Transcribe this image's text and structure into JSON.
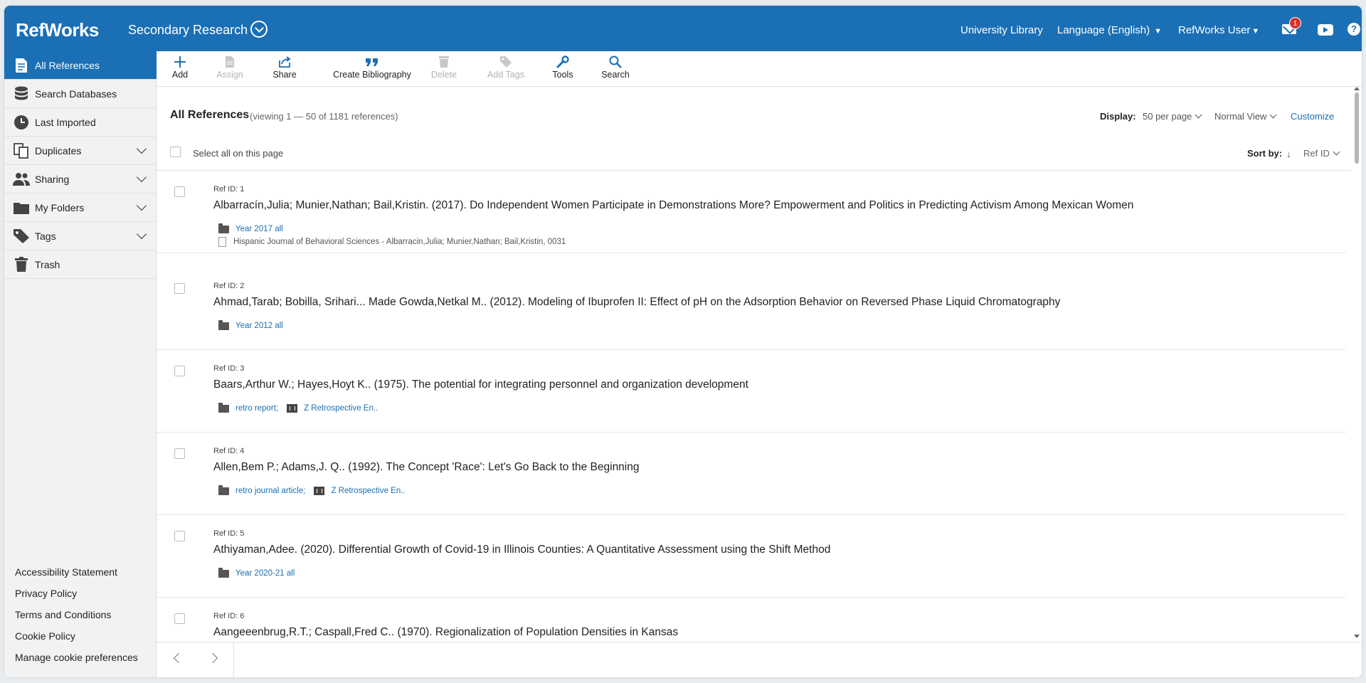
{
  "header": {
    "logo": "RefWorks",
    "project": "Secondary Research",
    "university_library": "University Library",
    "language": "Language (English)",
    "user": "RefWorks User",
    "mail_count": "1",
    "help": "?"
  },
  "sidebar": {
    "items": [
      {
        "label": "All References",
        "icon": "document-icon"
      },
      {
        "label": "Search Databases",
        "icon": "database-icon"
      },
      {
        "label": "Last Imported",
        "icon": "clock-icon"
      },
      {
        "label": "Duplicates",
        "icon": "duplicate-icon"
      },
      {
        "label": "Sharing",
        "icon": "users-icon"
      },
      {
        "label": "My Folders",
        "icon": "folder-icon"
      },
      {
        "label": "Tags",
        "icon": "tag-icon"
      },
      {
        "label": "Trash",
        "icon": "trash-icon"
      }
    ],
    "footer": [
      "Accessibility Statement",
      "Privacy Policy",
      "Terms and Conditions",
      "Cookie Policy",
      "Manage cookie preferences"
    ]
  },
  "toolbar": {
    "add": "Add",
    "assign": "Assign",
    "share": "Share",
    "create_bibliography": "Create Bibliography",
    "delete": "Delete",
    "add_tags": "Add Tags",
    "tools": "Tools",
    "search": "Search"
  },
  "list": {
    "title": "All References",
    "viewing": "(viewing 1 — 50 of 1181 references)",
    "display_label": "Display:",
    "per_page": "50 per page",
    "view_mode": "Normal View",
    "customize": "Customize",
    "select_all": "Select all on this page",
    "sort_label": "Sort by:",
    "sort_value": "Ref ID"
  },
  "references": [
    {
      "ref_id": "Ref ID: 1",
      "title": "Albarracín,Julia; Munier,Nathan; Bail,Kristin. (2017). Do Independent Women Participate in Demonstrations More? Empowerment and Politics in Predicting Activism Among Mexican Women",
      "folder": "Year 2017 all",
      "project": "",
      "source": "Hispanic Journal of Behavioral Sciences - Albarracin,Julia; Munier,Nathan; Bail,Kristin, 0031"
    },
    {
      "ref_id": "Ref ID: 2",
      "title": "Ahmad,Tarab; Bobilla, Srihari... Made Gowda,Netkal M.. (2012). Modeling of Ibuprofen II: Effect of pH on the Adsorption Behavior on Reversed Phase Liquid Chromatography",
      "folder": "Year 2012 all",
      "project": "",
      "source": ""
    },
    {
      "ref_id": "Ref ID: 3",
      "title": "Baars,Arthur W.; Hayes,Hoyt K.. (1975). The potential for integrating personnel and organization development",
      "folder": "retro report;",
      "project": "Z Retrospective En..",
      "source": ""
    },
    {
      "ref_id": "Ref ID: 4",
      "title": "Allen,Bem P.; Adams,J. Q.. (1992). The Concept 'Race': Let's Go Back to the Beginning",
      "folder": "retro journal article;",
      "project": "Z Retrospective En..",
      "source": ""
    },
    {
      "ref_id": "Ref ID: 5",
      "title": "Athiyaman,Adee. (2020). Differential Growth of Covid-19 in Illinois Counties: A Quantitative Assessment using the Shift Method",
      "folder": "Year 2020-21 all",
      "project": "",
      "source": ""
    },
    {
      "ref_id": "Ref ID: 6",
      "title": "Aangeeenbrug,R.T.; Caspall,Fred C.. (1970). Regionalization of Population Densities in Kansas",
      "folder": "",
      "project": "",
      "source": ""
    }
  ],
  "colors": {
    "brand": "#1a6fb5",
    "badge": "#d9302b",
    "sidebar_bg": "#f2f2f2"
  }
}
